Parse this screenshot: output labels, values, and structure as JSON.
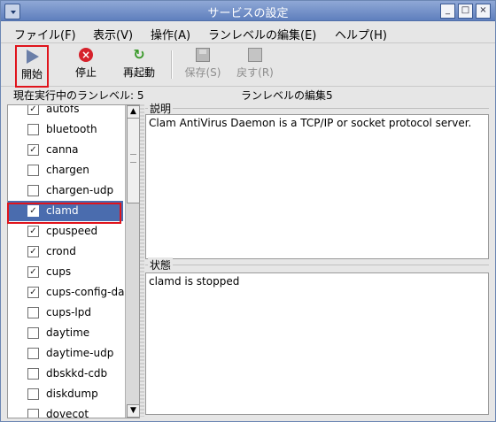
{
  "window": {
    "title": "サービスの設定"
  },
  "menu": [
    {
      "label": "ファイル(F)"
    },
    {
      "label": "表示(V)"
    },
    {
      "label": "操作(A)"
    },
    {
      "label": "ランレベルの編集(E)"
    },
    {
      "label": "ヘルプ(H)"
    }
  ],
  "toolbar": {
    "start_label": "開始",
    "stop_label": "停止",
    "restart_label": "再起動",
    "save_label": "保存(S)",
    "revert_label": "戻す(R)"
  },
  "status_line": {
    "current_runlevel": "現在実行中のランレベル: 5",
    "edit_runlevel": "ランレベルの編集5"
  },
  "services": [
    {
      "name": "autofs",
      "checked": true
    },
    {
      "name": "bluetooth",
      "checked": false
    },
    {
      "name": "canna",
      "checked": true
    },
    {
      "name": "chargen",
      "checked": false
    },
    {
      "name": "chargen-udp",
      "checked": false
    },
    {
      "name": "clamd",
      "checked": true,
      "selected": true
    },
    {
      "name": "cpuspeed",
      "checked": true
    },
    {
      "name": "crond",
      "checked": true
    },
    {
      "name": "cups",
      "checked": true
    },
    {
      "name": "cups-config-da",
      "checked": true
    },
    {
      "name": "cups-lpd",
      "checked": false
    },
    {
      "name": "daytime",
      "checked": false
    },
    {
      "name": "daytime-udp",
      "checked": false
    },
    {
      "name": "dbskkd-cdb",
      "checked": false
    },
    {
      "name": "diskdump",
      "checked": false
    },
    {
      "name": "dovecot",
      "checked": false
    }
  ],
  "description": {
    "label": "説明",
    "text": "Clam AntiVirus Daemon is a TCP/IP or socket protocol server."
  },
  "state": {
    "label": "状態",
    "text": "clamd is stopped"
  }
}
